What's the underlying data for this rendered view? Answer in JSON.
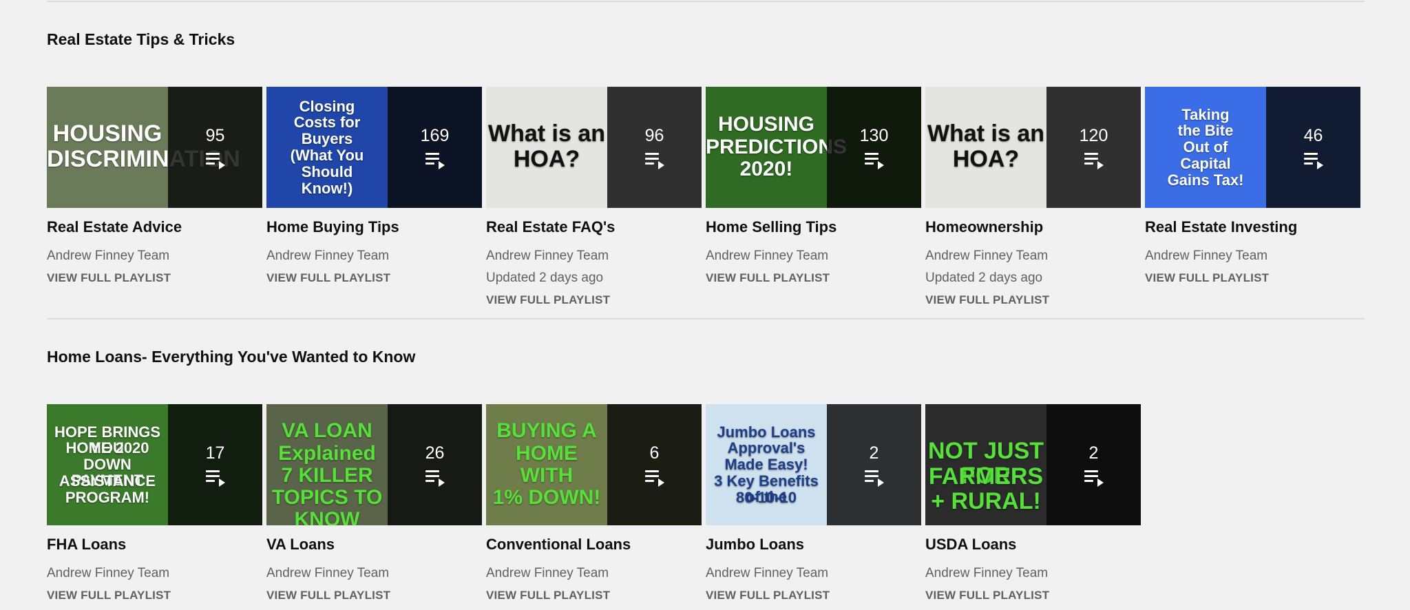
{
  "shelves": [
    {
      "title": "Real Estate Tips & Tricks",
      "playlists": [
        {
          "title": "Real Estate Advice",
          "channel": "Andrew Finney Team",
          "updated": "",
          "cta": "VIEW FULL PLAYLIST",
          "count": "95",
          "thumb_text": [
            "HOUSING",
            "DISCRIMINATION"
          ],
          "thumb_color": "#6b7b5a",
          "text_color": "#ffffff"
        },
        {
          "title": "Home Buying Tips",
          "channel": "Andrew Finney Team",
          "updated": "",
          "cta": "VIEW FULL PLAYLIST",
          "count": "169",
          "thumb_text": [
            "Closing",
            "Costs for",
            "Buyers",
            "(What You",
            "Should",
            "Know!)"
          ],
          "thumb_color": "#1f46a8",
          "text_color": "#ffffff"
        },
        {
          "title": "Real Estate FAQ's",
          "channel": "Andrew Finney Team",
          "updated": "Updated 2 days ago",
          "cta": "VIEW FULL PLAYLIST",
          "count": "96",
          "thumb_text": [
            "What is an",
            "HOA?"
          ],
          "thumb_color": "#e4e4e2",
          "text_color": "#111111"
        },
        {
          "title": "Home Selling Tips",
          "channel": "Andrew Finney Team",
          "updated": "",
          "cta": "VIEW FULL PLAYLIST",
          "count": "130",
          "thumb_text": [
            "HOUSING",
            "PREDICTIONS",
            "2020!"
          ],
          "thumb_color": "#2f6b23",
          "text_color": "#ffffff"
        },
        {
          "title": "Homeownership",
          "channel": "Andrew Finney Team",
          "updated": "Updated 2 days ago",
          "cta": "VIEW FULL PLAYLIST",
          "count": "120",
          "thumb_text": [
            "What is an",
            "HOA?"
          ],
          "thumb_color": "#e4e4e2",
          "text_color": "#111111"
        },
        {
          "title": "Real Estate Investing",
          "channel": "Andrew Finney Team",
          "updated": "",
          "cta": "VIEW FULL PLAYLIST",
          "count": "46",
          "thumb_text": [
            "Taking",
            "the Bite",
            "Out of",
            "Capital",
            "Gains Tax!"
          ],
          "thumb_color": "#3b6ee6",
          "text_color": "#ffffff"
        }
      ]
    },
    {
      "title": "Home Loans- Everything You've Wanted to Know",
      "playlists": [
        {
          "title": "FHA Loans",
          "channel": "Andrew Finney Team",
          "updated": "",
          "cta": "VIEW FULL PLAYLIST",
          "count": "17",
          "thumb_text": [
            "HOPE BRINGS YOU",
            "HOME 2020",
            "DOWN PAYMENT",
            "ASSISTANCE",
            "PROGRAM!"
          ],
          "thumb_color": "#3a7a2a",
          "text_color": "#ffffff"
        },
        {
          "title": "VA Loans",
          "channel": "Andrew Finney Team",
          "updated": "",
          "cta": "VIEW FULL PLAYLIST",
          "count": "26",
          "thumb_text": [
            "VA LOAN",
            "Explained",
            "7 KILLER",
            "TOPICS TO KNOW"
          ],
          "thumb_color": "#5a6448",
          "text_color": "#57e03a"
        },
        {
          "title": "Conventional Loans",
          "channel": "Andrew Finney Team",
          "updated": "",
          "cta": "VIEW FULL PLAYLIST",
          "count": "6",
          "thumb_text": [
            "BUYING A",
            "HOME",
            "WITH",
            "1% DOWN!"
          ],
          "thumb_color": "#6f7d4a",
          "text_color": "#57e03a"
        },
        {
          "title": "Jumbo Loans",
          "channel": "Andrew Finney Team",
          "updated": "",
          "cta": "VIEW FULL PLAYLIST",
          "count": "2",
          "thumb_text": [
            "Jumbo Loans",
            "Approval's",
            "Made Easy!",
            "3 Key Benefits of the",
            "80-10-10"
          ],
          "thumb_color": "#cfe1ef",
          "text_color": "#1c3f8a"
        },
        {
          "title": "USDA Loans",
          "channel": "Andrew Finney Team",
          "updated": "",
          "cta": "VIEW FULL PLAYLIST",
          "count": "2",
          "thumb_text": [
            "NOT JUST FOR",
            "FARMERS + RURAL!"
          ],
          "thumb_color": "#2b2b2b",
          "text_color": "#57e03a"
        }
      ]
    }
  ]
}
